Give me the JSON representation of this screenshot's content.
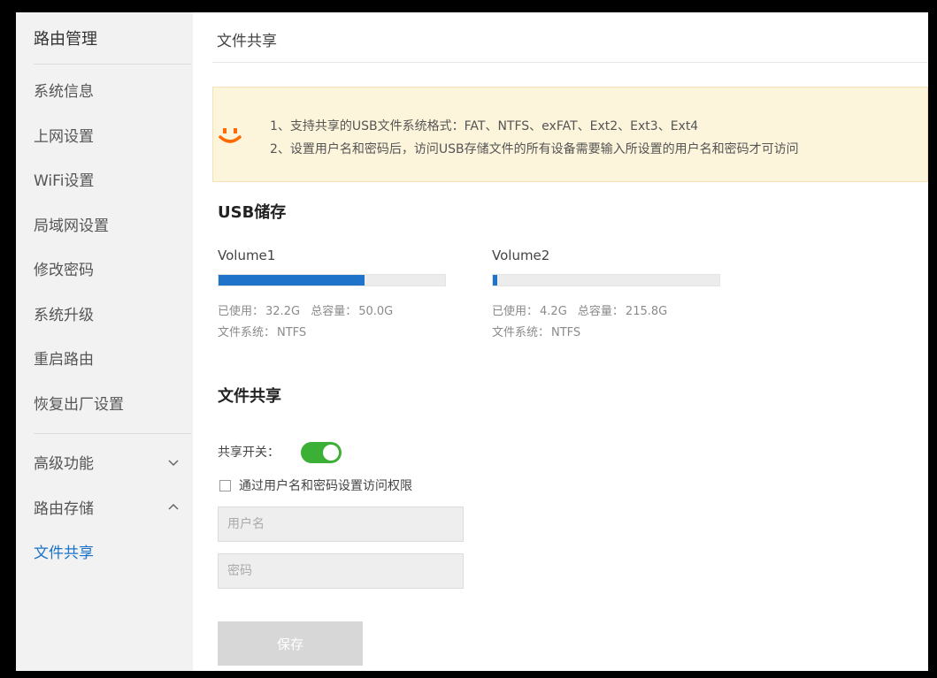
{
  "sidebar": {
    "title": "路由管理",
    "items": [
      {
        "label": "系统信息"
      },
      {
        "label": "上网设置"
      },
      {
        "label": "WiFi设置"
      },
      {
        "label": "局域网设置"
      },
      {
        "label": "修改密码"
      },
      {
        "label": "系统升级"
      },
      {
        "label": "重启路由"
      },
      {
        "label": "恢复出厂设置"
      }
    ],
    "groups": [
      {
        "label": "高级功能",
        "icon": "chevron-down-icon"
      },
      {
        "label": "路由存储",
        "icon": "chevron-up-icon"
      }
    ],
    "active_item": "文件共享"
  },
  "main": {
    "title": "文件共享",
    "notice": {
      "icon": "smiley-icon",
      "line1": "1、支持共享的USB文件系统格式：FAT、NTFS、exFAT、Ext2、Ext3、Ext4",
      "line2": "2、设置用户名和密码后，访问USB存储文件的所有设备需要输入所设置的用户名和密码才可访问"
    },
    "usb_title": "USB储存",
    "volumes": [
      {
        "name": "Volume1",
        "used_label": "已使用：",
        "used": "32.2G",
        "total_label": "总容量：",
        "total": "50.0G",
        "fs_label": "文件系统：",
        "fs": "NTFS",
        "usage_fraction": 0.644
      },
      {
        "name": "Volume2",
        "used_label": "已使用：",
        "used": "4.2G",
        "total_label": "总容量：",
        "total": "215.8G",
        "fs_label": "文件系统：",
        "fs": "NTFS",
        "usage_fraction": 0.019
      }
    ],
    "share_title": "文件共享",
    "share_switch_label": "共享开关：",
    "share_switch_on": true,
    "auth_checkbox_label": "通过用户名和密码设置访问权限",
    "username_placeholder": "用户名",
    "password_placeholder": "密码",
    "save_label": "保存"
  },
  "colors": {
    "accent": "#1f73c8",
    "toggle_on": "#3cb034",
    "notice_bg": "#fdf4dc",
    "smile": "#ff6a00"
  }
}
